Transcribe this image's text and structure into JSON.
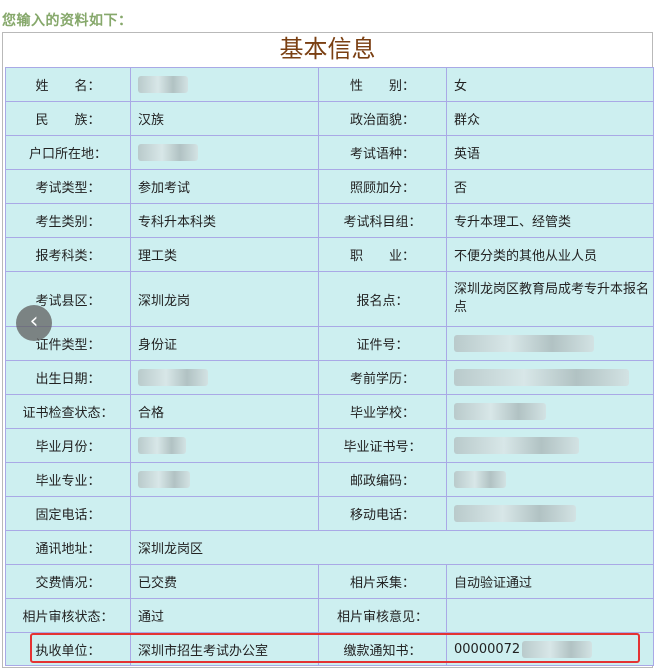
{
  "header": {
    "note": "您输入的资料如下："
  },
  "table": {
    "title": "基本信息",
    "rows": [
      {
        "l1": "姓　　名：",
        "v1": "",
        "l2": "性　　别：",
        "v2": "女"
      },
      {
        "l1": "民　　族：",
        "v1": "汉族",
        "l2": "政治面貌：",
        "v2": "群众"
      },
      {
        "l1": "户口所在地：",
        "v1": "",
        "l2": "考试语种：",
        "v2": "英语"
      },
      {
        "l1": "考试类型：",
        "v1": "参加考试",
        "l2": "照顾加分：",
        "v2": "否"
      },
      {
        "l1": "考生类别：",
        "v1": "专科升本科类",
        "l2": "考试科目组：",
        "v2": "专升本理工、经管类"
      },
      {
        "l1": "报考科类：",
        "v1": "理工类",
        "l2": "职　　业：",
        "v2": "不便分类的其他从业人员"
      },
      {
        "l1": "考试县区：",
        "v1": "深圳龙岗",
        "l2": "报名点：",
        "v2": "深圳龙岗区教育局成考专升本报名点"
      },
      {
        "l1": "证件类型：",
        "v1": "身份证",
        "l2": "证件号：",
        "v2": ""
      },
      {
        "l1": "出生日期：",
        "v1": "",
        "l2": "考前学历：",
        "v2": ""
      },
      {
        "l1": "证书检查状态：",
        "v1": "合格",
        "l2": "毕业学校：",
        "v2": ""
      },
      {
        "l1": "毕业月份：",
        "v1": "",
        "l2": "毕业证书号：",
        "v2": ""
      },
      {
        "l1": "毕业专业：",
        "v1": "",
        "l2": "邮政编码：",
        "v2": ""
      },
      {
        "l1": "固定电话：",
        "v1": "",
        "l2": "移动电话：",
        "v2": ""
      },
      {
        "l1": "通讯地址：",
        "v1": "深圳龙岗区"
      },
      {
        "l1": "交费情况：",
        "v1": "已交费",
        "l2": "相片采集：",
        "v2": "自动验证通过"
      },
      {
        "l1": "相片审核状态：",
        "v1": "通过",
        "l2": "相片审核意见：",
        "v2": ""
      },
      {
        "l1": "执收单位：",
        "v1": "深圳市招生考试办公室",
        "l2": "缴款通知书：",
        "v2": "00000072"
      }
    ]
  },
  "nav": {
    "prev_symbol": "‹"
  },
  "colors": {
    "cell_bg": "#cdeff0",
    "border": "#a9a9e6",
    "title": "#7a3f12",
    "highlight": "#e43333",
    "note": "#86a86b"
  }
}
